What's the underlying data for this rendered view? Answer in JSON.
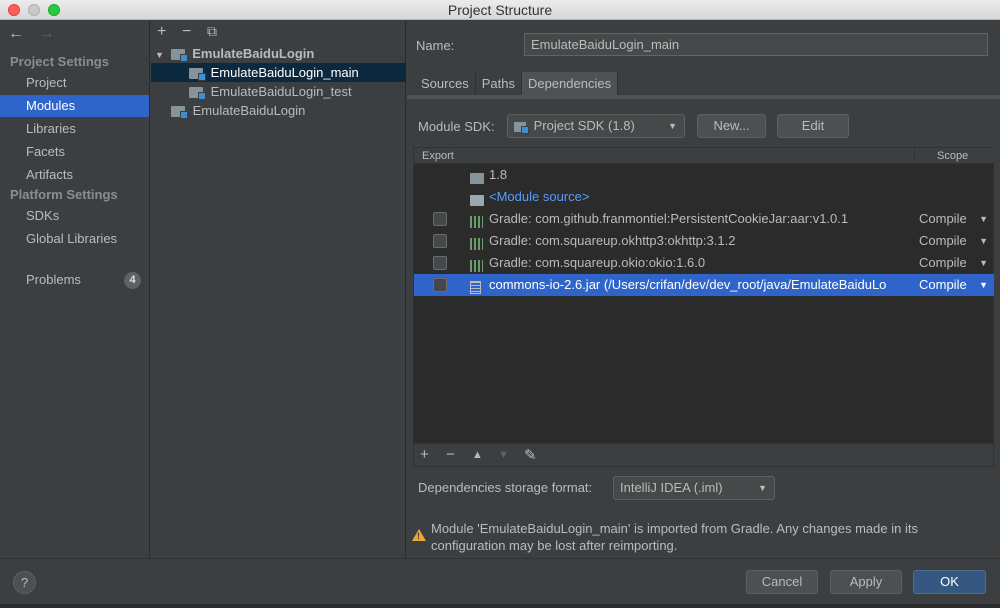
{
  "window": {
    "title": "Project Structure"
  },
  "nav": {
    "back_icon": "←",
    "forward_icon": "→",
    "project_settings_header": "Project Settings",
    "project_settings": [
      {
        "label": "Project",
        "selected": false
      },
      {
        "label": "Modules",
        "selected": true
      },
      {
        "label": "Libraries",
        "selected": false
      },
      {
        "label": "Facets",
        "selected": false
      },
      {
        "label": "Artifacts",
        "selected": false
      }
    ],
    "platform_settings_header": "Platform Settings",
    "platform_settings": [
      {
        "label": "SDKs"
      },
      {
        "label": "Global Libraries"
      }
    ],
    "problems_label": "Problems",
    "problems_count": "4"
  },
  "tree": {
    "toolbar": {
      "add": "+",
      "remove": "−",
      "copy": "⧉"
    },
    "root": "EmulateBaiduLogin",
    "children": [
      "EmulateBaiduLogin_main",
      "EmulateBaiduLogin_test"
    ],
    "sibling": "EmulateBaiduLogin",
    "selected": "EmulateBaiduLogin_main"
  },
  "module": {
    "name_label": "Name:",
    "name_value": "EmulateBaiduLogin_main",
    "tabs": [
      {
        "label": "Sources",
        "active": false
      },
      {
        "label": "Paths",
        "active": false
      },
      {
        "label": "Dependencies",
        "active": true
      }
    ],
    "sdk_label": "Module SDK:",
    "sdk_value": "Project SDK (1.8)",
    "new_button": "New...",
    "edit_button": "Edit"
  },
  "dependencies": {
    "columns": {
      "export": "Export",
      "scope": "Scope"
    },
    "rows": [
      {
        "icon": "folder-icon",
        "name": "1.8",
        "checkbox": false,
        "scope": "",
        "link": false,
        "selected": false
      },
      {
        "icon": "module-source-icon",
        "name": "<Module source>",
        "checkbox": false,
        "scope": "",
        "link": true,
        "selected": false
      },
      {
        "icon": "library-icon",
        "name": "Gradle: com.github.franmontiel:PersistentCookieJar:aar:v1.0.1",
        "checkbox": true,
        "scope": "Compile",
        "link": false,
        "selected": false
      },
      {
        "icon": "library-icon",
        "name": "Gradle: com.squareup.okhttp3:okhttp:3.1.2",
        "checkbox": true,
        "scope": "Compile",
        "link": false,
        "selected": false
      },
      {
        "icon": "library-icon",
        "name": "Gradle: com.squareup.okio:okio:1.6.0",
        "checkbox": true,
        "scope": "Compile",
        "link": false,
        "selected": false
      },
      {
        "icon": "jar-icon",
        "name": "commons-io-2.6.jar (/Users/crifan/dev/dev_root/java/EmulateBaiduLo",
        "checkbox": true,
        "scope": "Compile",
        "link": false,
        "selected": true
      }
    ],
    "toolbar": {
      "add": "+",
      "remove": "−",
      "up": "▲",
      "down": "▼",
      "edit": "✎"
    },
    "storage_label": "Dependencies storage format:",
    "storage_value": "IntelliJ IDEA (.iml)"
  },
  "warning": {
    "line1": "Module 'EmulateBaiduLogin_main' is imported from Gradle. Any changes made in its",
    "line2": "configuration may be lost after reimporting."
  },
  "footer": {
    "help": "?",
    "cancel": "Cancel",
    "apply": "Apply",
    "ok": "OK"
  },
  "colors": {
    "accent": "#2f65ca",
    "background": "#3c3f41",
    "table_bg": "#2b2b2b",
    "link": "#589df6",
    "warning": "#f0a732"
  }
}
